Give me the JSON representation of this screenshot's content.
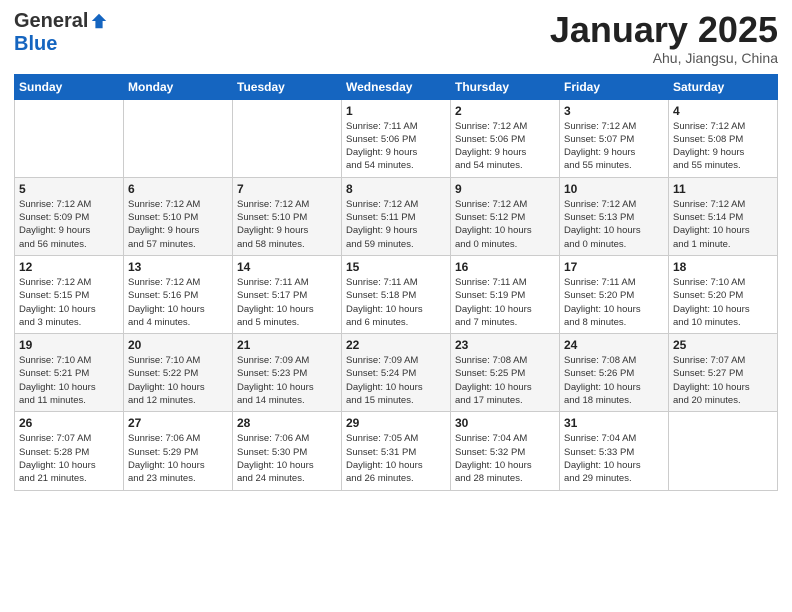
{
  "header": {
    "logo_general": "General",
    "logo_blue": "Blue",
    "month_title": "January 2025",
    "location": "Ahu, Jiangsu, China"
  },
  "weekdays": [
    "Sunday",
    "Monday",
    "Tuesday",
    "Wednesday",
    "Thursday",
    "Friday",
    "Saturday"
  ],
  "weeks": [
    {
      "row_class": "row-week1",
      "days": [
        {
          "num": "",
          "info": ""
        },
        {
          "num": "",
          "info": ""
        },
        {
          "num": "",
          "info": ""
        },
        {
          "num": "1",
          "info": "Sunrise: 7:11 AM\nSunset: 5:06 PM\nDaylight: 9 hours\nand 54 minutes."
        },
        {
          "num": "2",
          "info": "Sunrise: 7:12 AM\nSunset: 5:06 PM\nDaylight: 9 hours\nand 54 minutes."
        },
        {
          "num": "3",
          "info": "Sunrise: 7:12 AM\nSunset: 5:07 PM\nDaylight: 9 hours\nand 55 minutes."
        },
        {
          "num": "4",
          "info": "Sunrise: 7:12 AM\nSunset: 5:08 PM\nDaylight: 9 hours\nand 55 minutes."
        }
      ]
    },
    {
      "row_class": "row-week2",
      "days": [
        {
          "num": "5",
          "info": "Sunrise: 7:12 AM\nSunset: 5:09 PM\nDaylight: 9 hours\nand 56 minutes."
        },
        {
          "num": "6",
          "info": "Sunrise: 7:12 AM\nSunset: 5:10 PM\nDaylight: 9 hours\nand 57 minutes."
        },
        {
          "num": "7",
          "info": "Sunrise: 7:12 AM\nSunset: 5:10 PM\nDaylight: 9 hours\nand 58 minutes."
        },
        {
          "num": "8",
          "info": "Sunrise: 7:12 AM\nSunset: 5:11 PM\nDaylight: 9 hours\nand 59 minutes."
        },
        {
          "num": "9",
          "info": "Sunrise: 7:12 AM\nSunset: 5:12 PM\nDaylight: 10 hours\nand 0 minutes."
        },
        {
          "num": "10",
          "info": "Sunrise: 7:12 AM\nSunset: 5:13 PM\nDaylight: 10 hours\nand 0 minutes."
        },
        {
          "num": "11",
          "info": "Sunrise: 7:12 AM\nSunset: 5:14 PM\nDaylight: 10 hours\nand 1 minute."
        }
      ]
    },
    {
      "row_class": "row-week3",
      "days": [
        {
          "num": "12",
          "info": "Sunrise: 7:12 AM\nSunset: 5:15 PM\nDaylight: 10 hours\nand 3 minutes."
        },
        {
          "num": "13",
          "info": "Sunrise: 7:12 AM\nSunset: 5:16 PM\nDaylight: 10 hours\nand 4 minutes."
        },
        {
          "num": "14",
          "info": "Sunrise: 7:11 AM\nSunset: 5:17 PM\nDaylight: 10 hours\nand 5 minutes."
        },
        {
          "num": "15",
          "info": "Sunrise: 7:11 AM\nSunset: 5:18 PM\nDaylight: 10 hours\nand 6 minutes."
        },
        {
          "num": "16",
          "info": "Sunrise: 7:11 AM\nSunset: 5:19 PM\nDaylight: 10 hours\nand 7 minutes."
        },
        {
          "num": "17",
          "info": "Sunrise: 7:11 AM\nSunset: 5:20 PM\nDaylight: 10 hours\nand 8 minutes."
        },
        {
          "num": "18",
          "info": "Sunrise: 7:10 AM\nSunset: 5:20 PM\nDaylight: 10 hours\nand 10 minutes."
        }
      ]
    },
    {
      "row_class": "row-week4",
      "days": [
        {
          "num": "19",
          "info": "Sunrise: 7:10 AM\nSunset: 5:21 PM\nDaylight: 10 hours\nand 11 minutes."
        },
        {
          "num": "20",
          "info": "Sunrise: 7:10 AM\nSunset: 5:22 PM\nDaylight: 10 hours\nand 12 minutes."
        },
        {
          "num": "21",
          "info": "Sunrise: 7:09 AM\nSunset: 5:23 PM\nDaylight: 10 hours\nand 14 minutes."
        },
        {
          "num": "22",
          "info": "Sunrise: 7:09 AM\nSunset: 5:24 PM\nDaylight: 10 hours\nand 15 minutes."
        },
        {
          "num": "23",
          "info": "Sunrise: 7:08 AM\nSunset: 5:25 PM\nDaylight: 10 hours\nand 17 minutes."
        },
        {
          "num": "24",
          "info": "Sunrise: 7:08 AM\nSunset: 5:26 PM\nDaylight: 10 hours\nand 18 minutes."
        },
        {
          "num": "25",
          "info": "Sunrise: 7:07 AM\nSunset: 5:27 PM\nDaylight: 10 hours\nand 20 minutes."
        }
      ]
    },
    {
      "row_class": "row-week5",
      "days": [
        {
          "num": "26",
          "info": "Sunrise: 7:07 AM\nSunset: 5:28 PM\nDaylight: 10 hours\nand 21 minutes."
        },
        {
          "num": "27",
          "info": "Sunrise: 7:06 AM\nSunset: 5:29 PM\nDaylight: 10 hours\nand 23 minutes."
        },
        {
          "num": "28",
          "info": "Sunrise: 7:06 AM\nSunset: 5:30 PM\nDaylight: 10 hours\nand 24 minutes."
        },
        {
          "num": "29",
          "info": "Sunrise: 7:05 AM\nSunset: 5:31 PM\nDaylight: 10 hours\nand 26 minutes."
        },
        {
          "num": "30",
          "info": "Sunrise: 7:04 AM\nSunset: 5:32 PM\nDaylight: 10 hours\nand 28 minutes."
        },
        {
          "num": "31",
          "info": "Sunrise: 7:04 AM\nSunset: 5:33 PM\nDaylight: 10 hours\nand 29 minutes."
        },
        {
          "num": "",
          "info": ""
        }
      ]
    }
  ]
}
